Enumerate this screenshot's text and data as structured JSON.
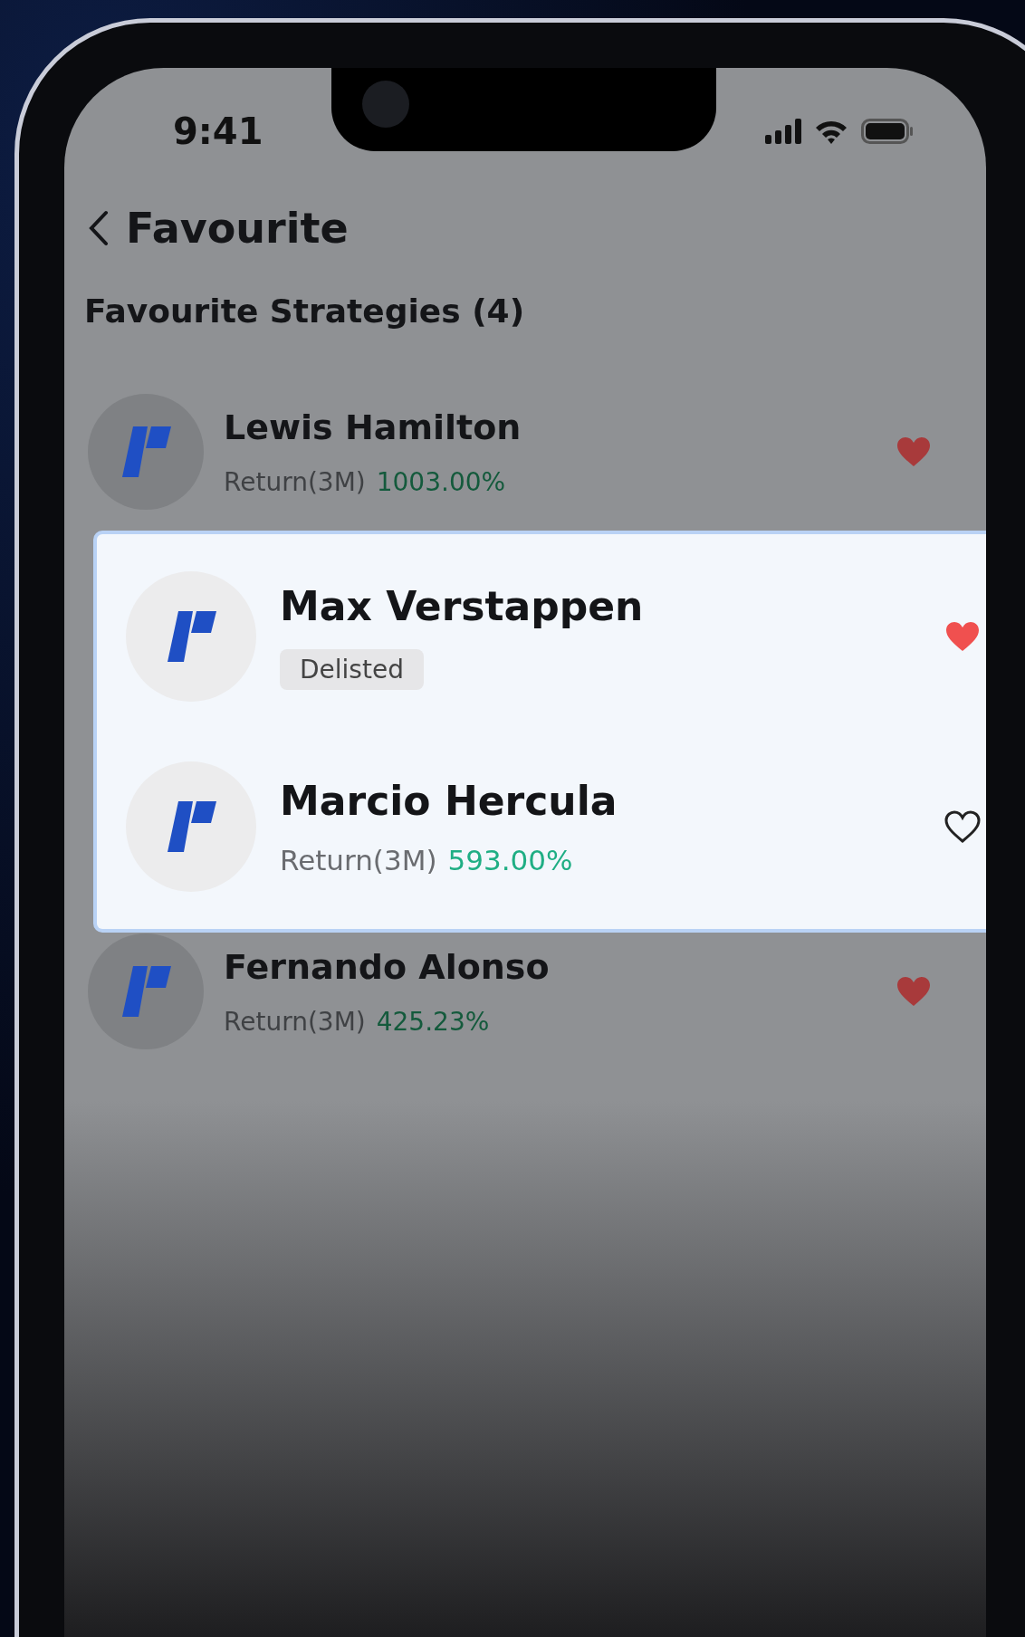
{
  "status_bar": {
    "time": "9:41"
  },
  "header": {
    "title": "Favourite"
  },
  "section_title": "Favourite Strategies (4)",
  "rows_before": [
    {
      "name": "Lewis Hamilton",
      "return_label": "Return(3M)",
      "return_value": "1003.00%",
      "favourited": true
    }
  ],
  "popup_rows": [
    {
      "name": "Max Verstappen",
      "badge": "Delisted",
      "favourited": true
    },
    {
      "name": "Marcio Hercula",
      "return_label": "Return(3M)",
      "return_value": "593.00%",
      "favourited": false
    }
  ],
  "rows_after": [
    {
      "name": "Fernando Alonso",
      "return_label": "Return(3M)",
      "return_value": "425.23%",
      "favourited": true
    }
  ]
}
